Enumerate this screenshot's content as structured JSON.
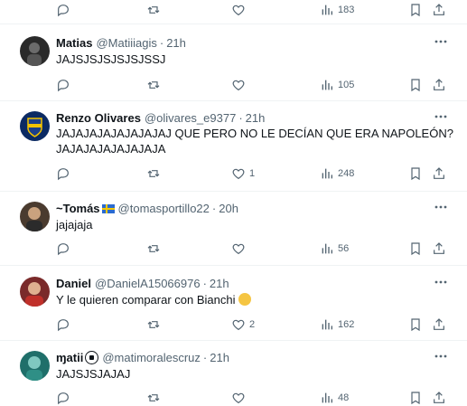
{
  "tweets": [
    {
      "id": "top",
      "stats": {
        "replies": "",
        "retweets": "",
        "likes": "",
        "views": "183"
      }
    },
    {
      "id": "matias",
      "name": "Matias",
      "handle": "@Matiiiagis",
      "time": "21h",
      "text": "JAJSJSJSJSJSJSSJ",
      "stats": {
        "replies": "",
        "retweets": "",
        "likes": "",
        "views": "105"
      }
    },
    {
      "id": "renzo",
      "name": "Renzo Olivares",
      "handle": "@olivares_e9377",
      "time": "21h",
      "text": "JAJAJAJAJAJAJAJAJ QUE PERO NO LE DECÍAN QUE ERA NAPOLEÓN?\nJAJAJAJAJAJAJAJA",
      "stats": {
        "replies": "",
        "retweets": "",
        "likes": "1",
        "views": "248"
      }
    },
    {
      "id": "tomas",
      "name": "~Tomás",
      "handle": "@tomasportillo22",
      "time": "20h",
      "text": "jajajaja",
      "stats": {
        "replies": "",
        "retweets": "",
        "likes": "",
        "views": "56"
      }
    },
    {
      "id": "daniel",
      "name": "Daniel",
      "handle": "@DanielA15066976",
      "time": "21h",
      "text": "Y le quieren comparar con Bianchi",
      "stats": {
        "replies": "",
        "retweets": "",
        "likes": "2",
        "views": "162"
      }
    },
    {
      "id": "matii",
      "name": "ɱatii",
      "handle": "@matimoralescruz",
      "time": "21h",
      "text": "JAJSJSJAJAJ",
      "stats": {
        "replies": "",
        "retweets": "",
        "likes": "",
        "views": "48"
      }
    }
  ],
  "dot": "·",
  "colors": {
    "text": "#0f1419",
    "secondary": "#536471",
    "separator": "#eff3f4"
  },
  "icons": [
    "reply-icon",
    "retweet-icon",
    "like-icon",
    "views-icon",
    "bookmark-icon",
    "share-icon",
    "more-icon"
  ]
}
